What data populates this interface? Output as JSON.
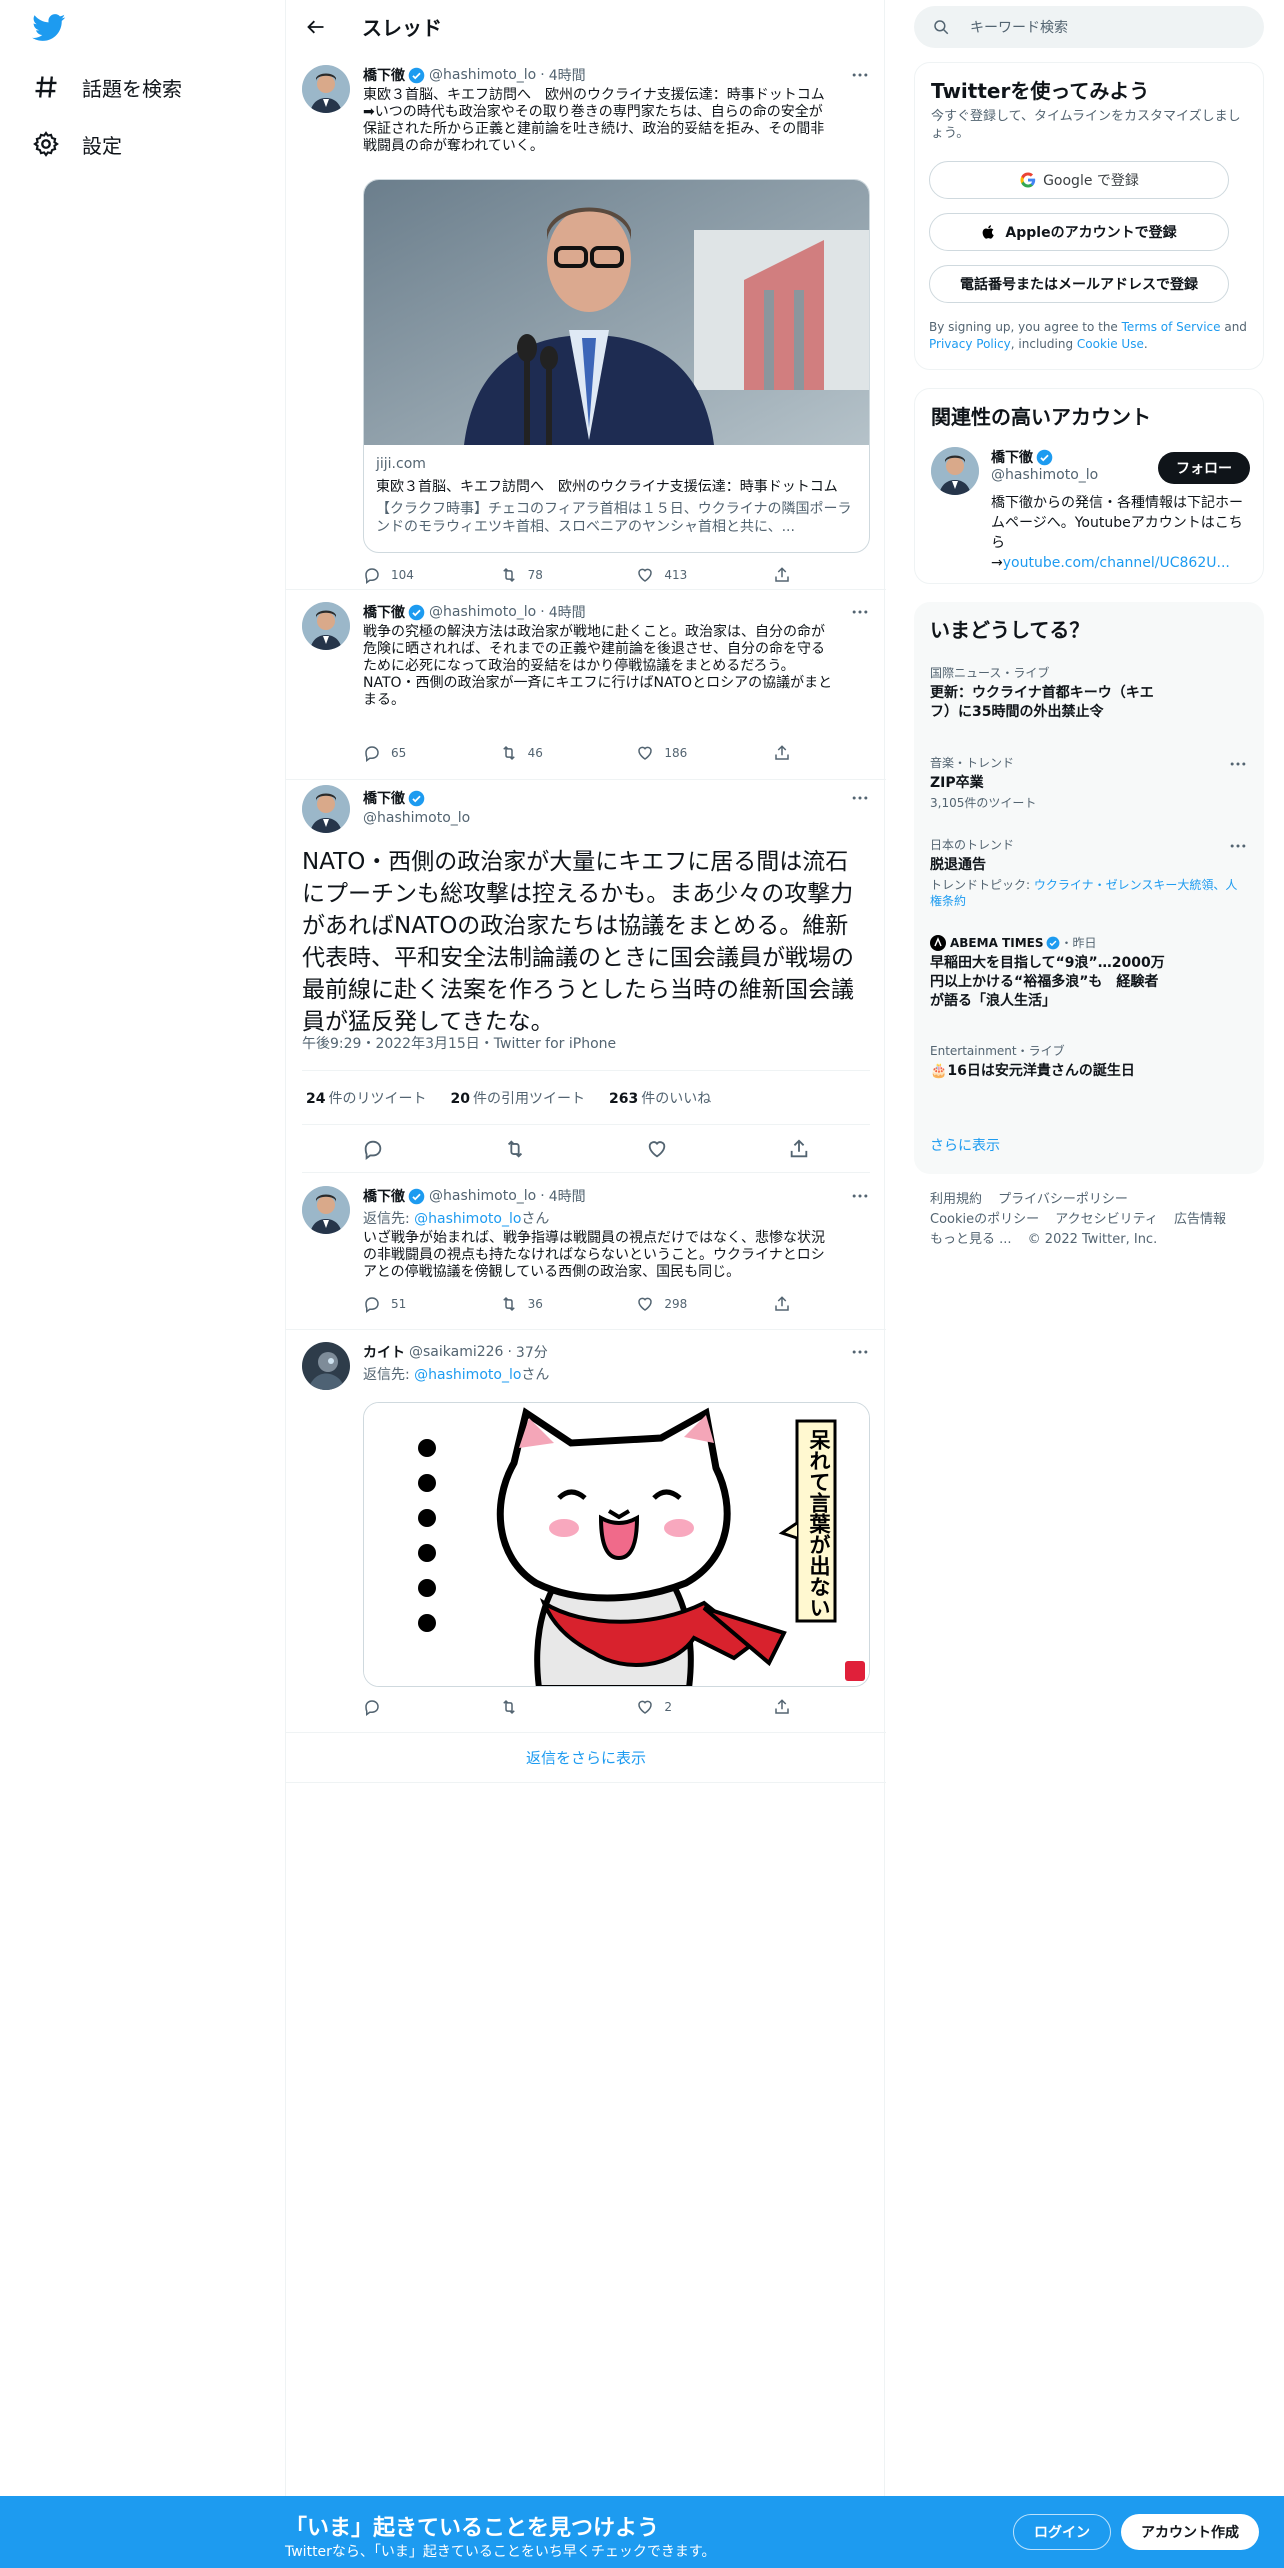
{
  "nav": {
    "items": [
      {
        "label": "話題を検索",
        "icon": "hashtag-icon"
      },
      {
        "label": "設定",
        "icon": "gear-icon"
      }
    ]
  },
  "header": {
    "title": "スレッド"
  },
  "tweets": {
    "t1": {
      "name": "橋下徹",
      "handle": "@hashimoto_lo",
      "time": "4時間",
      "text": "東欧３首脳、キエフ訪問へ　欧州のウクライナ支援伝達：時事ドットコム\n➡いつの時代も政治家やその取り巻きの専門家たちは、自らの命の安全が\n保証された所から正義と建前論を吐き続け、政治的妥結を拒み、その間非\n戦闘員の命が奪われていく。",
      "card": {
        "domain": "jiji.com",
        "title": "東欧３首脳、キエフ訪問へ　欧州のウクライナ支援伝達：時事ドットコム",
        "desc": "【クラクフ時事】チェコのフィアラ首相は１５日、ウクライナの隣国ポーランドのモラウィエツキ首相、スロベニアのヤンシャ首相と共に、..."
      },
      "replies": "104",
      "retweets": "78",
      "likes": "413"
    },
    "t2": {
      "name": "橋下徹",
      "handle": "@hashimoto_lo",
      "time": "4時間",
      "text": "戦争の究極の解決方法は政治家が戦地に赴くこと。政治家は、自分の命が\n危険に晒されれば、それまでの正義や建前論を後退させ、自分の命を守る\nために必死になって政治的妥結をはかり停戦協議をまとめるだろう。\nNATO・西側の政治家が一斉にキエフに行けばNATOとロシアの協議がまと\nまる。",
      "replies": "65",
      "retweets": "46",
      "likes": "186"
    },
    "main": {
      "name": "橋下徹",
      "handle": "@hashimoto_lo",
      "text": "NATO・西側の政治家が大量にキエフに居る間は流石\nにプーチンも総攻撃は控えるかも。まあ少々の攻撃力\nがあればNATOの政治家たちは協議をまとめる。維新\n代表時、平和安全法制論議のときに国会議員が戦場の\n最前線に赴く法案を作ろうとしたら当時の維新国会議\n員が猛反発してきたな。",
      "meta": "午後9:29・2022年3月15日・Twitter for iPhone",
      "retweets": "24",
      "retweets_label": "件のリツイート",
      "quotes": "20",
      "quotes_label": "件の引用ツイート",
      "likes": "263",
      "likes_label": "件のいいね"
    },
    "t3": {
      "name": "橋下徹",
      "handle": "@hashimoto_lo",
      "time": "4時間",
      "reply_prefix": "返信先: ",
      "reply_to": "@hashimoto_lo",
      "reply_suffix": "さん",
      "text": "いざ戦争が始まれば、戦争指導は戦闘員の視点だけではなく、悲惨な状況\nの非戦闘員の視点も持たなければならないということ。ウクライナとロシ\nアとの停戦協議を傍観している西側の政治家、国民も同じ。",
      "replies": "51",
      "retweets": "36",
      "likes": "298"
    },
    "t4": {
      "name": "カイト",
      "handle": "@saikami226",
      "time": "37分",
      "reply_prefix": "返信先: ",
      "reply_to": "@hashimoto_lo",
      "reply_suffix": "さん",
      "sticker_text": "呆れて言葉が出ない",
      "likes": "2"
    }
  },
  "show_more_replies": "返信をさらに表示",
  "search": {
    "placeholder": "キーワード検索"
  },
  "signup_panel": {
    "title": "Twitterを使ってみよう",
    "subtitle": "今すぐ登録して、タイムラインをカスタマイズしましょう。",
    "google": "Google で登録",
    "apple": "Appleのアカウントで登録",
    "phone": "電話番号またはメールアドレスで登録",
    "legal_1": "By signing up, you agree to the ",
    "tos": "Terms of Service",
    "legal_2": " and ",
    "privacy": "Privacy Policy",
    "legal_3": ", including ",
    "cookie": "Cookie Use",
    "legal_4": "."
  },
  "related": {
    "title": "関連性の高いアカウント",
    "name": "橋下徹",
    "handle": "@hashimoto_lo",
    "follow": "フォロー",
    "bio": "橋下徹からの発信・各種情報は下記ホームページへ。Youtubeアカウントはこちら\n→",
    "link": "youtube.com/channel/UC862U..."
  },
  "trends": {
    "title": "いまどうしてる？",
    "items": [
      {
        "meta": "国際ニュース・ライブ",
        "title": "更新：ウクライナ首都キーウ（キエフ）に35時間の外出禁止令"
      },
      {
        "meta": "音楽・トレンド",
        "title": "ZIP卒業",
        "sub": "3,105件のツイート"
      },
      {
        "meta": "日本のトレンド",
        "title": "脱退通告",
        "sub_prefix": "トレンドトピック: ",
        "sub_link": "ウクライナ・ゼレンスキー大統領、人権条約"
      },
      {
        "meta_name": "ABEMA TIMES",
        "meta_time": "・昨日",
        "title": "早稲田大を目指して“9浪”…2000万円以上かける“裕福多浪”も　経験者が語る「浪人生活」"
      },
      {
        "meta": "Entertainment・ライブ",
        "title": "🎂16日は安元洋貴さんの誕生日"
      }
    ],
    "show_more": "さらに表示"
  },
  "footer": {
    "links": [
      "利用規約",
      "プライバシーポリシー",
      "Cookieのポリシー",
      "アクセシビリティ",
      "広告情報",
      "もっと見る ...",
      "© 2022 Twitter, Inc."
    ]
  },
  "bottom_bar": {
    "title": "「いま」起きていることを見つけよう",
    "subtitle": "Twitterなら、「いま」起きていることをいち早くチェックできます。",
    "login": "ログイン",
    "signup": "アカウント作成"
  },
  "colors": {
    "accent": "#1d9bf0",
    "text": "#0f1419",
    "secondary": "#536471",
    "border": "#eff3f4"
  }
}
